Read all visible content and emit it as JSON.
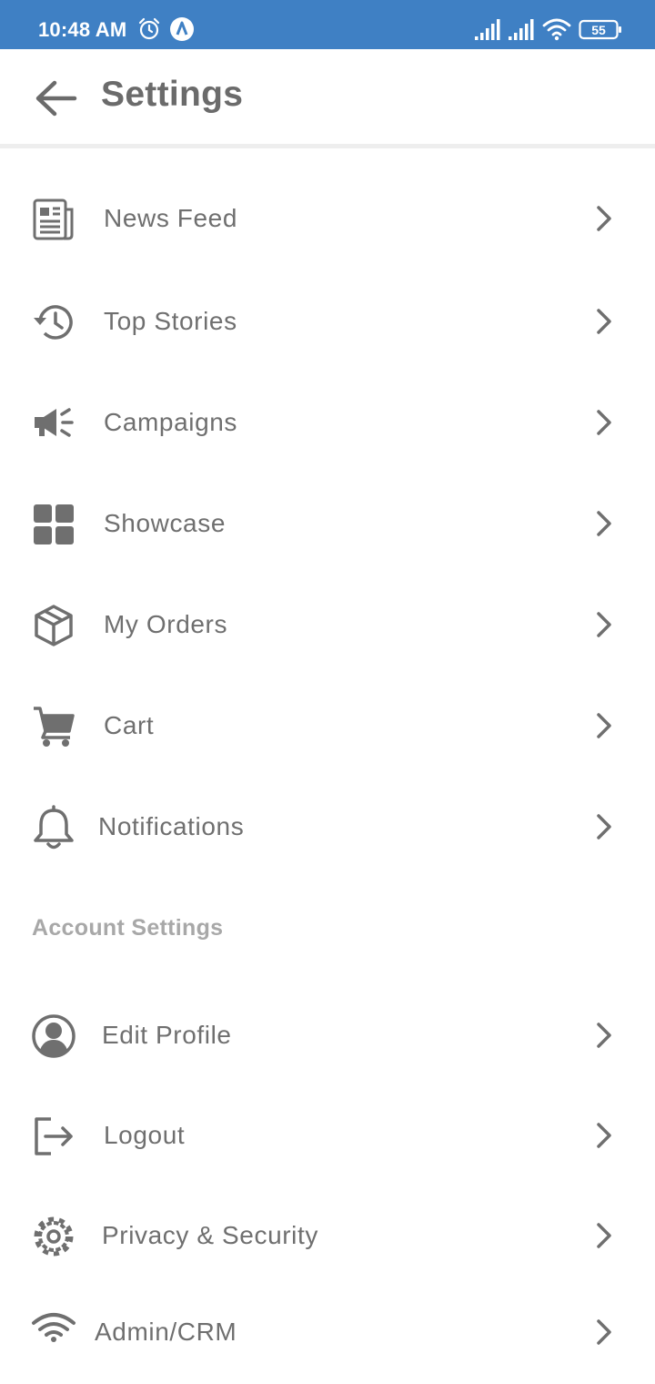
{
  "status_bar": {
    "time": "10:48 AM",
    "battery": "55",
    "icons": [
      "alarm-icon",
      "app-notification-icon",
      "signal-icon",
      "signal-icon",
      "wifi-icon",
      "battery-icon"
    ]
  },
  "header": {
    "title": "Settings",
    "back_icon": "arrow-left-icon"
  },
  "menu": {
    "items": [
      {
        "label": "News Feed",
        "icon": "newspaper-icon"
      },
      {
        "label": "Top Stories",
        "icon": "history-icon"
      },
      {
        "label": "Campaigns",
        "icon": "megaphone-icon"
      },
      {
        "label": "Showcase",
        "icon": "grid-icon"
      },
      {
        "label": "My Orders",
        "icon": "package-icon"
      },
      {
        "label": "Cart",
        "icon": "cart-icon"
      },
      {
        "label": "Notifications",
        "icon": "bell-icon"
      }
    ]
  },
  "account": {
    "section_title": "Account Settings",
    "items": [
      {
        "label": "Edit Profile",
        "icon": "user-circle-icon"
      },
      {
        "label": "Logout",
        "icon": "logout-icon"
      },
      {
        "label": "Privacy & Security",
        "icon": "gear-icon"
      },
      {
        "label": "Admin/CRM",
        "icon": "wifi-icon"
      }
    ]
  },
  "colors": {
    "status_bar": "#3f80c4",
    "text": "#6f6f6f",
    "section_title": "#a8a8a8",
    "divider": "#eeeeee"
  }
}
